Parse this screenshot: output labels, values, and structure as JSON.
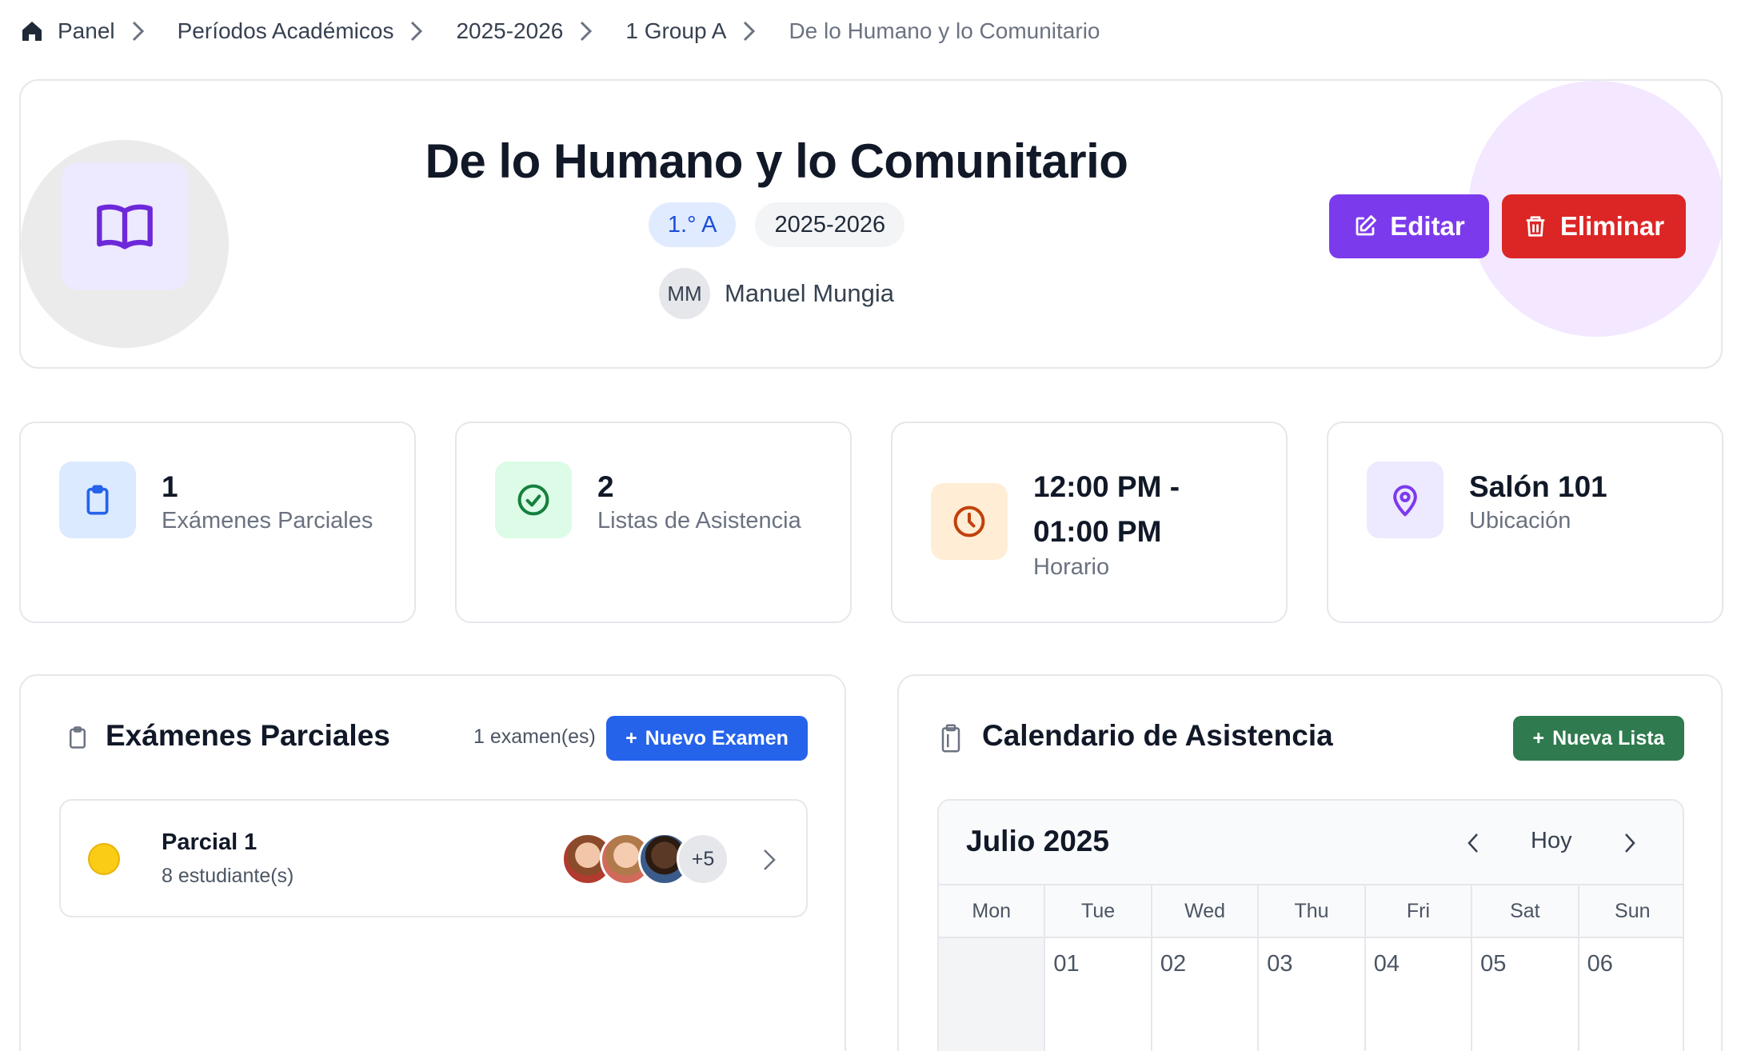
{
  "breadcrumb": {
    "items": [
      {
        "label": "Panel"
      },
      {
        "label": "Períodos Académicos"
      },
      {
        "label": "2025-2026"
      },
      {
        "label": "1 Group A"
      }
    ],
    "current": "De lo Humano y lo Comunitario"
  },
  "header": {
    "title": "De lo Humano y lo Comunitario",
    "tag_class": "1.° A",
    "tag_period": "2025-2026",
    "teacher_initials": "MM",
    "teacher_name": "Manuel Mungia",
    "edit_label": "Editar",
    "delete_label": "Eliminar",
    "icon": "book-open-icon"
  },
  "stats": [
    {
      "value": "1",
      "label": "Exámenes Parciales",
      "icon": "clipboard-icon",
      "color": "#2563eb"
    },
    {
      "value": "2",
      "label": "Listas de Asistencia",
      "icon": "check-circle-icon",
      "color": "#15803d"
    },
    {
      "value_line1": "12:00 PM -",
      "value_line2": "01:00 PM",
      "label": "Horario",
      "icon": "clock-icon",
      "color": "#c2410c"
    },
    {
      "value": "Salón 101",
      "label": "Ubicación",
      "icon": "map-pin-icon",
      "color": "#7c3aed"
    }
  ],
  "exams": {
    "title": "Exámenes Parciales",
    "count": "1 examen(es)",
    "new_button": "Nuevo Examen",
    "items": [
      {
        "name": "Parcial 1",
        "students": "8 estudiante(s)",
        "more": "+5"
      }
    ]
  },
  "attendance": {
    "title": "Calendario de Asistencia",
    "new_button": "Nueva Lista",
    "month": "Julio 2025",
    "today_label": "Hoy",
    "weekdays": [
      "Mon",
      "Tue",
      "Wed",
      "Thu",
      "Fri",
      "Sat",
      "Sun"
    ],
    "first_week": [
      "",
      "01",
      "02",
      "03",
      "04",
      "05",
      "06"
    ]
  },
  "colors": {
    "primary_purple": "#7c3aed",
    "danger": "#dc2626",
    "blue": "#2563eb",
    "green": "#2f7a4f"
  }
}
